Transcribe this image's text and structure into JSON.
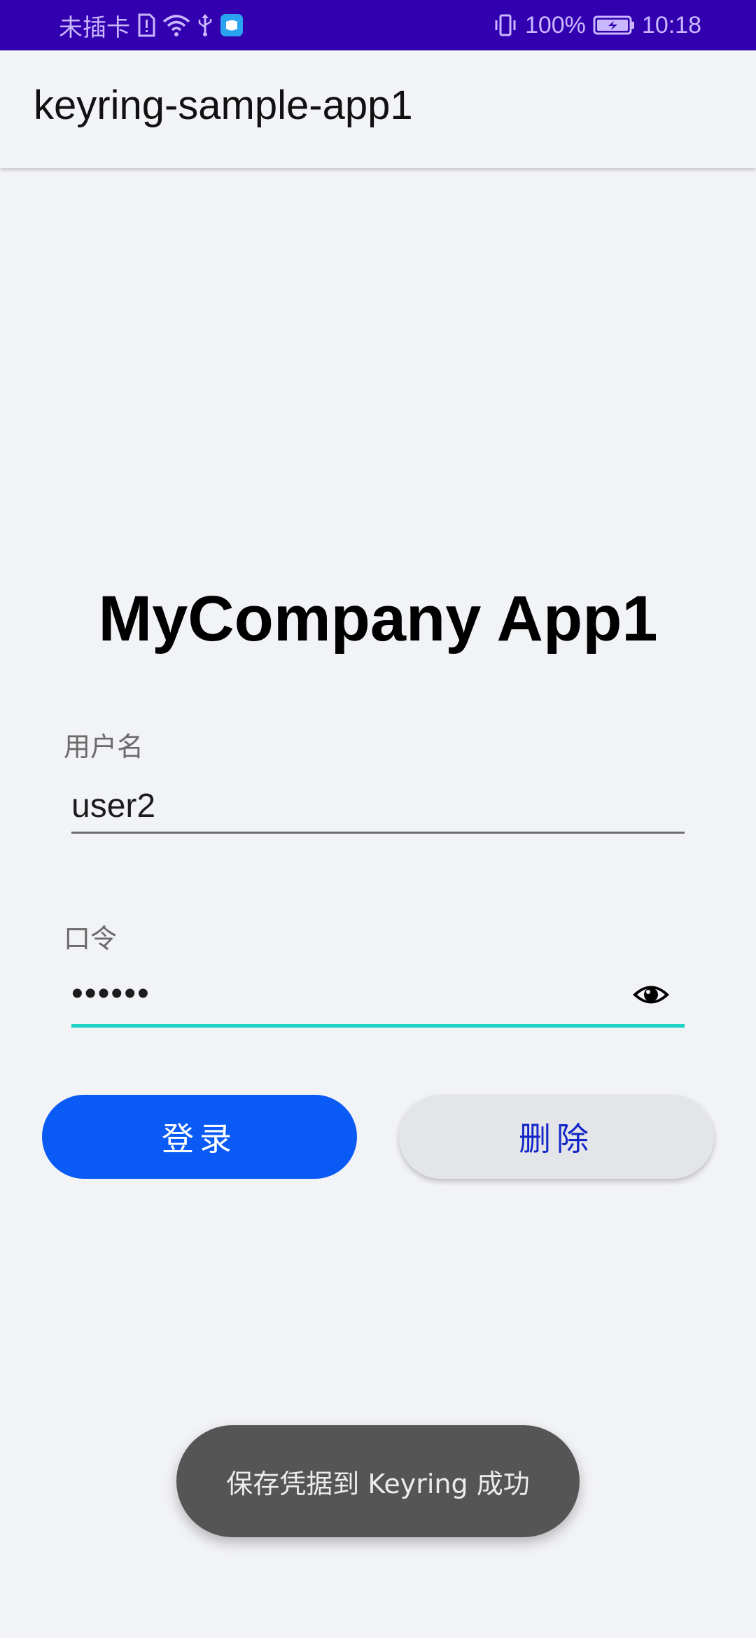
{
  "status_bar": {
    "carrier": "未插卡",
    "battery_percent": "100%",
    "time": "10:18",
    "icons": [
      "sim-alert-icon",
      "wifi-icon",
      "usb-icon",
      "notification-app-icon",
      "vibrate-icon",
      "battery-charging-icon"
    ]
  },
  "app_bar": {
    "title": "keyring-sample-app1"
  },
  "main": {
    "heading": "MyCompany App1",
    "username": {
      "label": "用户名",
      "value": "user2"
    },
    "password": {
      "label": "口令",
      "value": "••••••",
      "visibility_icon": "eye-icon"
    },
    "buttons": {
      "login": "登录",
      "delete": "删除"
    }
  },
  "toast": {
    "message": "保存凭据到 Keyring 成功"
  },
  "colors": {
    "status_bar": "#3300b0",
    "background": "#f2f3f6",
    "primary_button": "#0a5af5",
    "secondary_button_text": "#1226c8",
    "focused_underline": "#1fd3c4",
    "toast_background": "#555555"
  }
}
